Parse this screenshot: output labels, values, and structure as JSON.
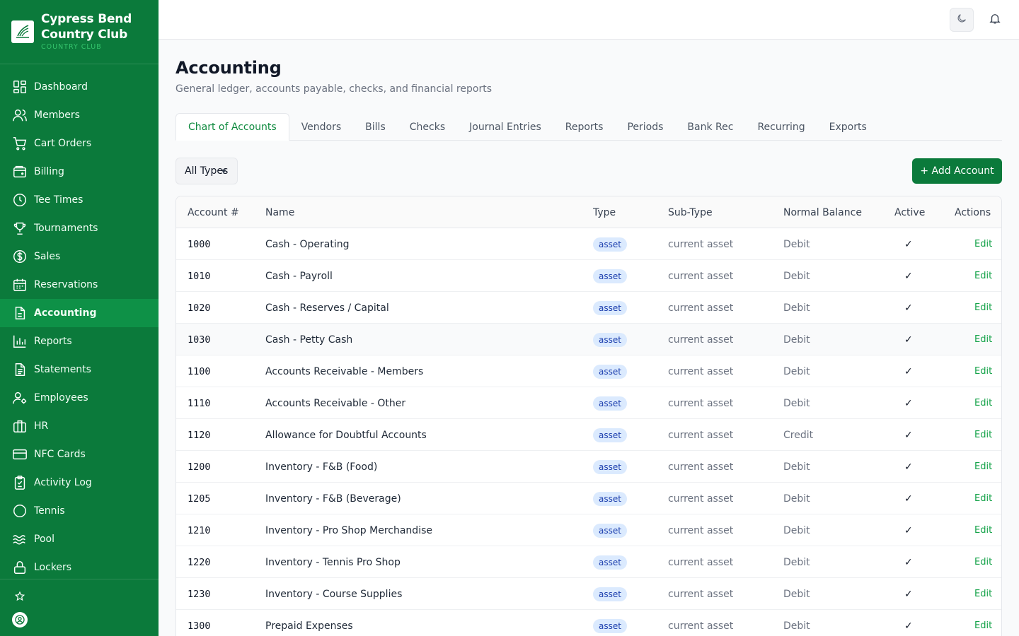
{
  "brand": {
    "title_line1": "Cypress Bend",
    "title_line2": "Country Club",
    "subtitle": "COUNTRY CLUB"
  },
  "sidebar": {
    "items": [
      {
        "label": "Dashboard",
        "icon": "grid-icon"
      },
      {
        "label": "Members",
        "icon": "users-icon"
      },
      {
        "label": "Cart Orders",
        "icon": "cart-icon"
      },
      {
        "label": "Billing",
        "icon": "wallet-icon"
      },
      {
        "label": "Tee Times",
        "icon": "clock-icon"
      },
      {
        "label": "Tournaments",
        "icon": "trophy-icon"
      },
      {
        "label": "Sales",
        "icon": "dollar-icon"
      },
      {
        "label": "Reservations",
        "icon": "calendar-icon"
      },
      {
        "label": "Accounting",
        "icon": "document-icon",
        "active": true
      },
      {
        "label": "Reports",
        "icon": "bar-chart-icon"
      },
      {
        "label": "Statements",
        "icon": "file-text-icon"
      },
      {
        "label": "Employees",
        "icon": "user-gear-icon"
      },
      {
        "label": "HR",
        "icon": "briefcase-icon"
      },
      {
        "label": "NFC Cards",
        "icon": "credit-card-icon"
      },
      {
        "label": "Activity Log",
        "icon": "clipboard-icon"
      },
      {
        "label": "Tennis",
        "icon": "circle-icon"
      },
      {
        "label": "Pool",
        "icon": "waves-icon"
      },
      {
        "label": "Lockers",
        "icon": "lock-icon"
      }
    ]
  },
  "page": {
    "title": "Accounting",
    "subtitle": "General ledger, accounts payable, checks, and financial reports"
  },
  "tabs": [
    "Chart of Accounts",
    "Vendors",
    "Bills",
    "Checks",
    "Journal Entries",
    "Reports",
    "Periods",
    "Bank Rec",
    "Recurring",
    "Exports"
  ],
  "filter": {
    "selected": "All Types"
  },
  "add_button": "+ Add Account",
  "table": {
    "headers": {
      "account": "Account #",
      "name": "Name",
      "type": "Type",
      "subtype": "Sub-Type",
      "balance": "Normal Balance",
      "active": "Active",
      "actions": "Actions"
    },
    "rows": [
      {
        "account": "1000",
        "name": "Cash - Operating",
        "type": "asset",
        "subtype": "current asset",
        "balance": "Debit",
        "active": "✓",
        "action": "Edit"
      },
      {
        "account": "1010",
        "name": "Cash - Payroll",
        "type": "asset",
        "subtype": "current asset",
        "balance": "Debit",
        "active": "✓",
        "action": "Edit"
      },
      {
        "account": "1020",
        "name": "Cash - Reserves / Capital",
        "type": "asset",
        "subtype": "current asset",
        "balance": "Debit",
        "active": "✓",
        "action": "Edit"
      },
      {
        "account": "1030",
        "name": "Cash - Petty Cash",
        "type": "asset",
        "subtype": "current asset",
        "balance": "Debit",
        "active": "✓",
        "action": "Edit"
      },
      {
        "account": "1100",
        "name": "Accounts Receivable - Members",
        "type": "asset",
        "subtype": "current asset",
        "balance": "Debit",
        "active": "✓",
        "action": "Edit"
      },
      {
        "account": "1110",
        "name": "Accounts Receivable - Other",
        "type": "asset",
        "subtype": "current asset",
        "balance": "Debit",
        "active": "✓",
        "action": "Edit"
      },
      {
        "account": "1120",
        "name": "Allowance for Doubtful Accounts",
        "type": "asset",
        "subtype": "current asset",
        "balance": "Credit",
        "active": "✓",
        "action": "Edit"
      },
      {
        "account": "1200",
        "name": "Inventory - F&B (Food)",
        "type": "asset",
        "subtype": "current asset",
        "balance": "Debit",
        "active": "✓",
        "action": "Edit"
      },
      {
        "account": "1205",
        "name": "Inventory - F&B (Beverage)",
        "type": "asset",
        "subtype": "current asset",
        "balance": "Debit",
        "active": "✓",
        "action": "Edit"
      },
      {
        "account": "1210",
        "name": "Inventory - Pro Shop Merchandise",
        "type": "asset",
        "subtype": "current asset",
        "balance": "Debit",
        "active": "✓",
        "action": "Edit"
      },
      {
        "account": "1220",
        "name": "Inventory - Tennis Pro Shop",
        "type": "asset",
        "subtype": "current asset",
        "balance": "Debit",
        "active": "✓",
        "action": "Edit"
      },
      {
        "account": "1230",
        "name": "Inventory - Course Supplies",
        "type": "asset",
        "subtype": "current asset",
        "balance": "Debit",
        "active": "✓",
        "action": "Edit"
      },
      {
        "account": "1300",
        "name": "Prepaid Expenses",
        "type": "asset",
        "subtype": "current asset",
        "balance": "Debit",
        "active": "✓",
        "action": "Edit"
      }
    ]
  },
  "colors": {
    "sidebar": "#0b7a3b",
    "sidebar_active": "#0e9147",
    "accent": "#16a34a",
    "badge_bg": "#dbeafe",
    "badge_text": "#1e40af"
  }
}
